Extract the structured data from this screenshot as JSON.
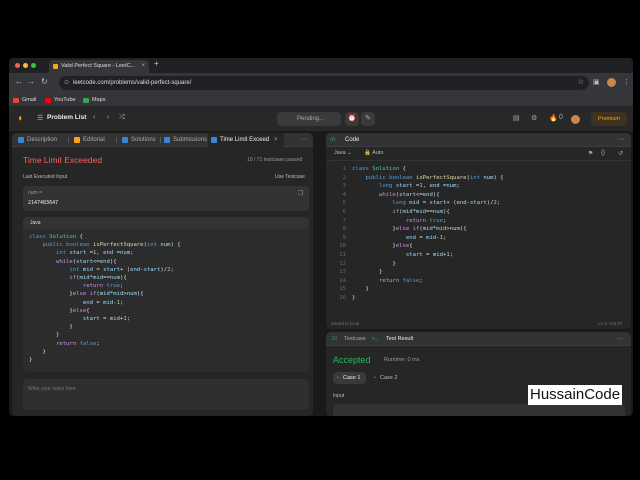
{
  "browser": {
    "tab_title": "Valid Perfect Square - LeetC...",
    "tab_close": "×",
    "new_tab": "+",
    "url": "leetcode.com/problems/valid-perfect-square/",
    "bookmarks": [
      {
        "label": "Gmail",
        "color": "#ea4335"
      },
      {
        "label": "YouTube",
        "color": "#ff0000"
      },
      {
        "label": "Maps",
        "color": "#34a853"
      }
    ]
  },
  "header": {
    "problem_list": "Problem List",
    "pending": "Pending...",
    "premium": "Premium",
    "streak": "0"
  },
  "left": {
    "tabs": [
      "Description",
      "Editorial",
      "Solutions",
      "Submissions",
      "Time Limit Exceed"
    ],
    "status": "Time Limit Exceeded",
    "passed": "10 / 71  testcases passed",
    "last_input_label": "Last Executed Input",
    "use_testcase": "Use Testcase",
    "num_label": "num =",
    "num_value": "2147483647",
    "code_lang": "Java",
    "notes_placeholder": "Write your notes here"
  },
  "editor": {
    "tab": "Code",
    "language": "Java",
    "auto": "Auto",
    "saved": "Saved to local",
    "cursor": "Ln 3, Col 27"
  },
  "result": {
    "testcase_tab": "Testcase",
    "result_tab": "Test Result",
    "status": "Accepted",
    "runtime": "Runtime: 0 ms",
    "case1": "Case 1",
    "case2": "Case 2",
    "input_label": "Input"
  },
  "watermark": "HussainCode",
  "colors": {
    "accent": "#ffa116",
    "error": "#f8615c",
    "success": "#2db55d"
  }
}
